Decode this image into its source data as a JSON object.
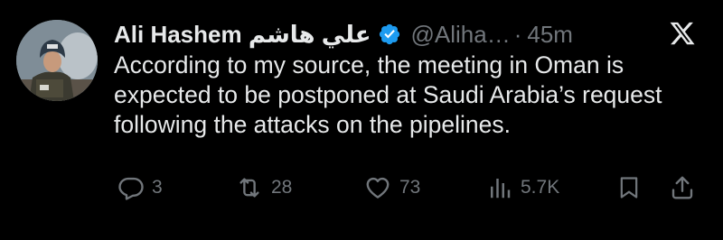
{
  "author": {
    "display_name": "Ali Hashem علي هاشم",
    "handle": "@Aliha…",
    "separator": "·",
    "time_ago": "45m",
    "verified": true
  },
  "tweet": {
    "text": "According to my source, the meeting in Oman is expected to be postponed at Saudi Arabia’s request following the attacks on the pipelines."
  },
  "actions": {
    "replies": "3",
    "retweets": "28",
    "likes": "73",
    "views": "5.7K"
  },
  "colors": {
    "background": "#000000",
    "text": "#e7e9ea",
    "muted": "#71767b",
    "verified": "#1d9bf0"
  },
  "icons": {
    "reply": "speech-bubble-icon",
    "retweet": "retweet-arrows-icon",
    "like": "heart-outline-icon",
    "views": "bar-chart-icon",
    "bookmark": "bookmark-icon",
    "share": "share-upload-icon",
    "brand": "x-logo-icon",
    "verified": "verified-badge-icon"
  }
}
